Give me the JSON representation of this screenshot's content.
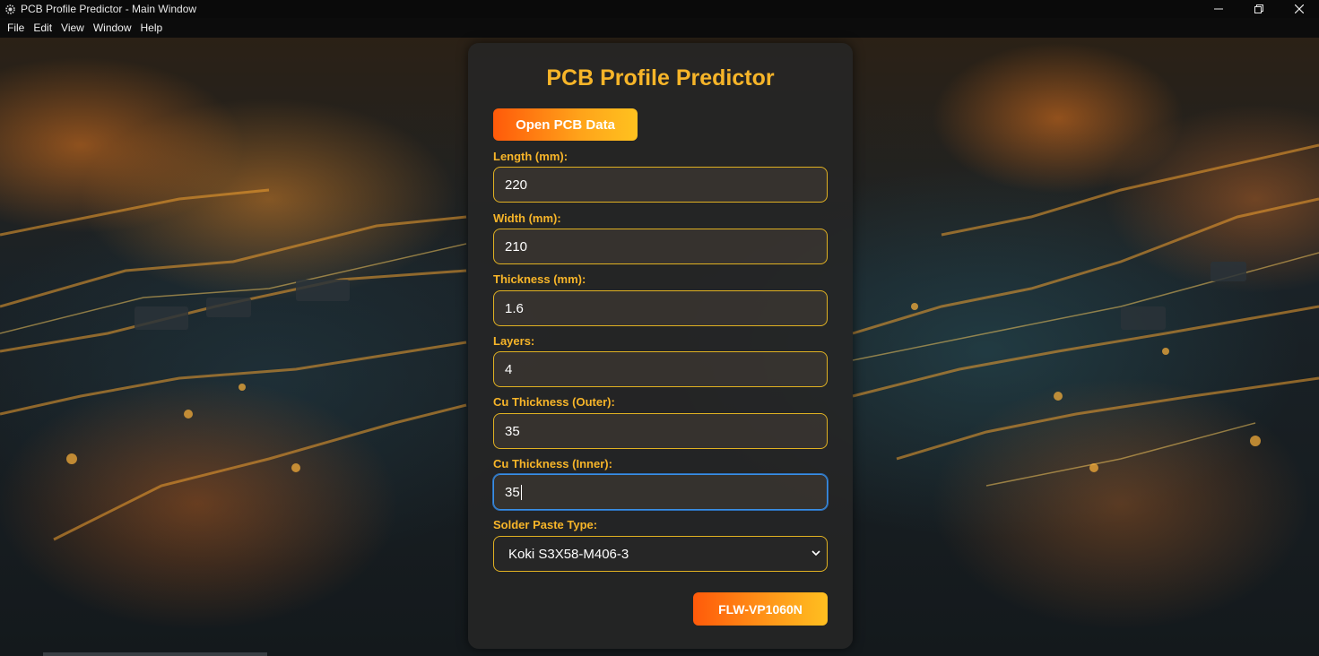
{
  "window": {
    "title": "PCB Profile Predictor - Main Window",
    "icon": "gear-app-icon"
  },
  "menu": {
    "items": [
      "File",
      "Edit",
      "View",
      "Window",
      "Help"
    ]
  },
  "panel": {
    "title": "PCB Profile Predictor",
    "open_button_label": "Open PCB Data",
    "fields": [
      {
        "label": "Length (mm):",
        "value": "220"
      },
      {
        "label": "Width (mm):",
        "value": "210"
      },
      {
        "label": "Thickness (mm):",
        "value": "1.6"
      },
      {
        "label": "Layers:",
        "value": "4"
      },
      {
        "label": "Cu Thickness (Outer):",
        "value": "35"
      },
      {
        "label": "Cu Thickness (Inner):",
        "value": "35"
      }
    ],
    "solder_label": "Solder Paste Type:",
    "solder_selected": "Koki S3X58-M406-3",
    "submit_label": "FLW-VP1060N"
  },
  "colors": {
    "accent": "#f7b529",
    "button_gradient_start": "#ff5a0a",
    "button_gradient_end": "#ffc21f",
    "focus_border": "#3a8fe6"
  }
}
